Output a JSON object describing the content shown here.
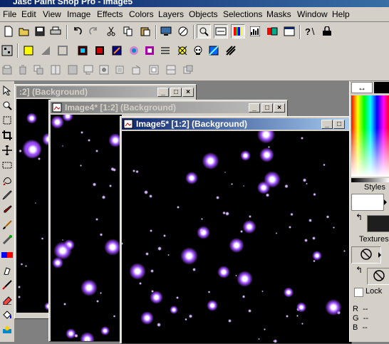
{
  "app": {
    "title": "Jasc Paint Shop Pro - Image5"
  },
  "menu": [
    "File",
    "Edit",
    "View",
    "Image",
    "Effects",
    "Colors",
    "Layers",
    "Objects",
    "Selections",
    "Masks",
    "Window",
    "Help"
  ],
  "windows": {
    "back": {
      "title": ":2] (Background)"
    },
    "middle": {
      "title": "Image4* [1:2] (Background)"
    },
    "front": {
      "title": "Image5* [1:2] (Background)"
    }
  },
  "palette": {
    "styles_label": "Styles",
    "textures_label": "Textures",
    "lock_label": "Lock",
    "rgb": [
      {
        "label": "R",
        "value": "--"
      },
      {
        "label": "G",
        "value": "--"
      },
      {
        "label": "B",
        "value": "--"
      }
    ],
    "background_color": "#1e1e1e",
    "foreground_color": "#ffffff"
  },
  "colors": {
    "title_active": "#0a246a",
    "star_purple": "#9d4dff",
    "canvas": "#000000"
  }
}
